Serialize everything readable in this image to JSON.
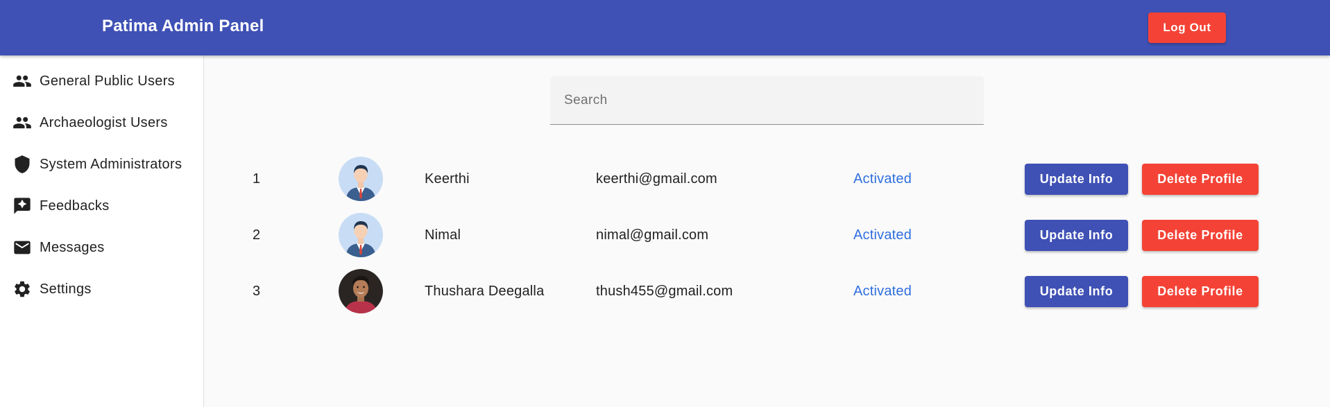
{
  "header": {
    "title": "Patima Admin Panel",
    "logout_label": "Log Out"
  },
  "sidebar": {
    "items": [
      {
        "label": "General Public Users",
        "icon": "people-icon"
      },
      {
        "label": "Archaeologist Users",
        "icon": "people-icon"
      },
      {
        "label": "System Administrators",
        "icon": "shield-icon"
      },
      {
        "label": "Feedbacks",
        "icon": "feedback-icon"
      },
      {
        "label": "Messages",
        "icon": "mail-icon"
      },
      {
        "label": "Settings",
        "icon": "gear-icon"
      }
    ]
  },
  "search": {
    "placeholder": "Search",
    "value": ""
  },
  "users": [
    {
      "index": "1",
      "name": "Keerthi",
      "email": "keerthi@gmail.com",
      "status": "Activated",
      "avatar": "default-avatar",
      "update_label": "Update Info",
      "delete_label": "Delete Profile"
    },
    {
      "index": "2",
      "name": "Nimal",
      "email": "nimal@gmail.com",
      "status": "Activated",
      "avatar": "default-avatar",
      "update_label": "Update Info",
      "delete_label": "Delete Profile"
    },
    {
      "index": "3",
      "name": "Thushara Deegalla",
      "email": "thush455@gmail.com",
      "status": "Activated",
      "avatar": "photo-avatar",
      "update_label": "Update Info",
      "delete_label": "Delete Profile"
    }
  ],
  "colors": {
    "primary": "#3f51b5",
    "danger": "#f44336",
    "status_link": "#2f6fe0"
  }
}
